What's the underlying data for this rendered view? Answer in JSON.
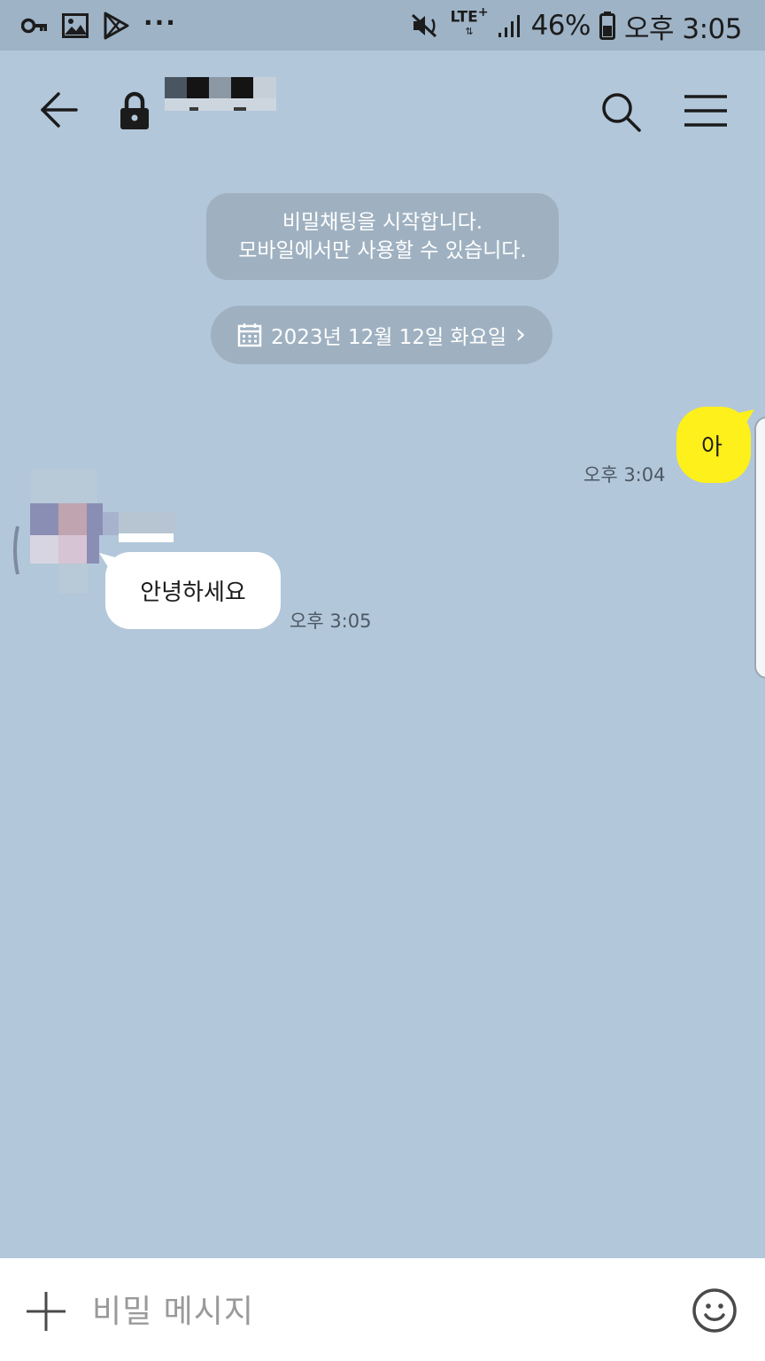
{
  "status_bar": {
    "icons_left": [
      "key-icon",
      "image-icon",
      "play-store-icon",
      "more-dots-icon"
    ],
    "more_dots": "···",
    "network": "LTE",
    "network_plus": "+",
    "battery_percent": "46%",
    "time": "오후 3:05"
  },
  "header": {
    "title": ""
  },
  "notice": {
    "line1": "비밀채팅을 시작합니다.",
    "line2": "모바일에서만 사용할 수 있습니다."
  },
  "date_divider": {
    "label": "2023년 12월 12일 화요일",
    "chevron": "›"
  },
  "messages": [
    {
      "side": "me",
      "text": "아",
      "time": "오후 3:04"
    },
    {
      "side": "other",
      "text": "안녕하세요",
      "time": "오후 3:05"
    }
  ],
  "input": {
    "placeholder": "비밀 메시지",
    "value": ""
  },
  "colors": {
    "chat_background": "#b2c7da",
    "my_bubble": "#fef01b",
    "their_bubble": "#ffffff",
    "status_bar": "#9eb3c6"
  }
}
